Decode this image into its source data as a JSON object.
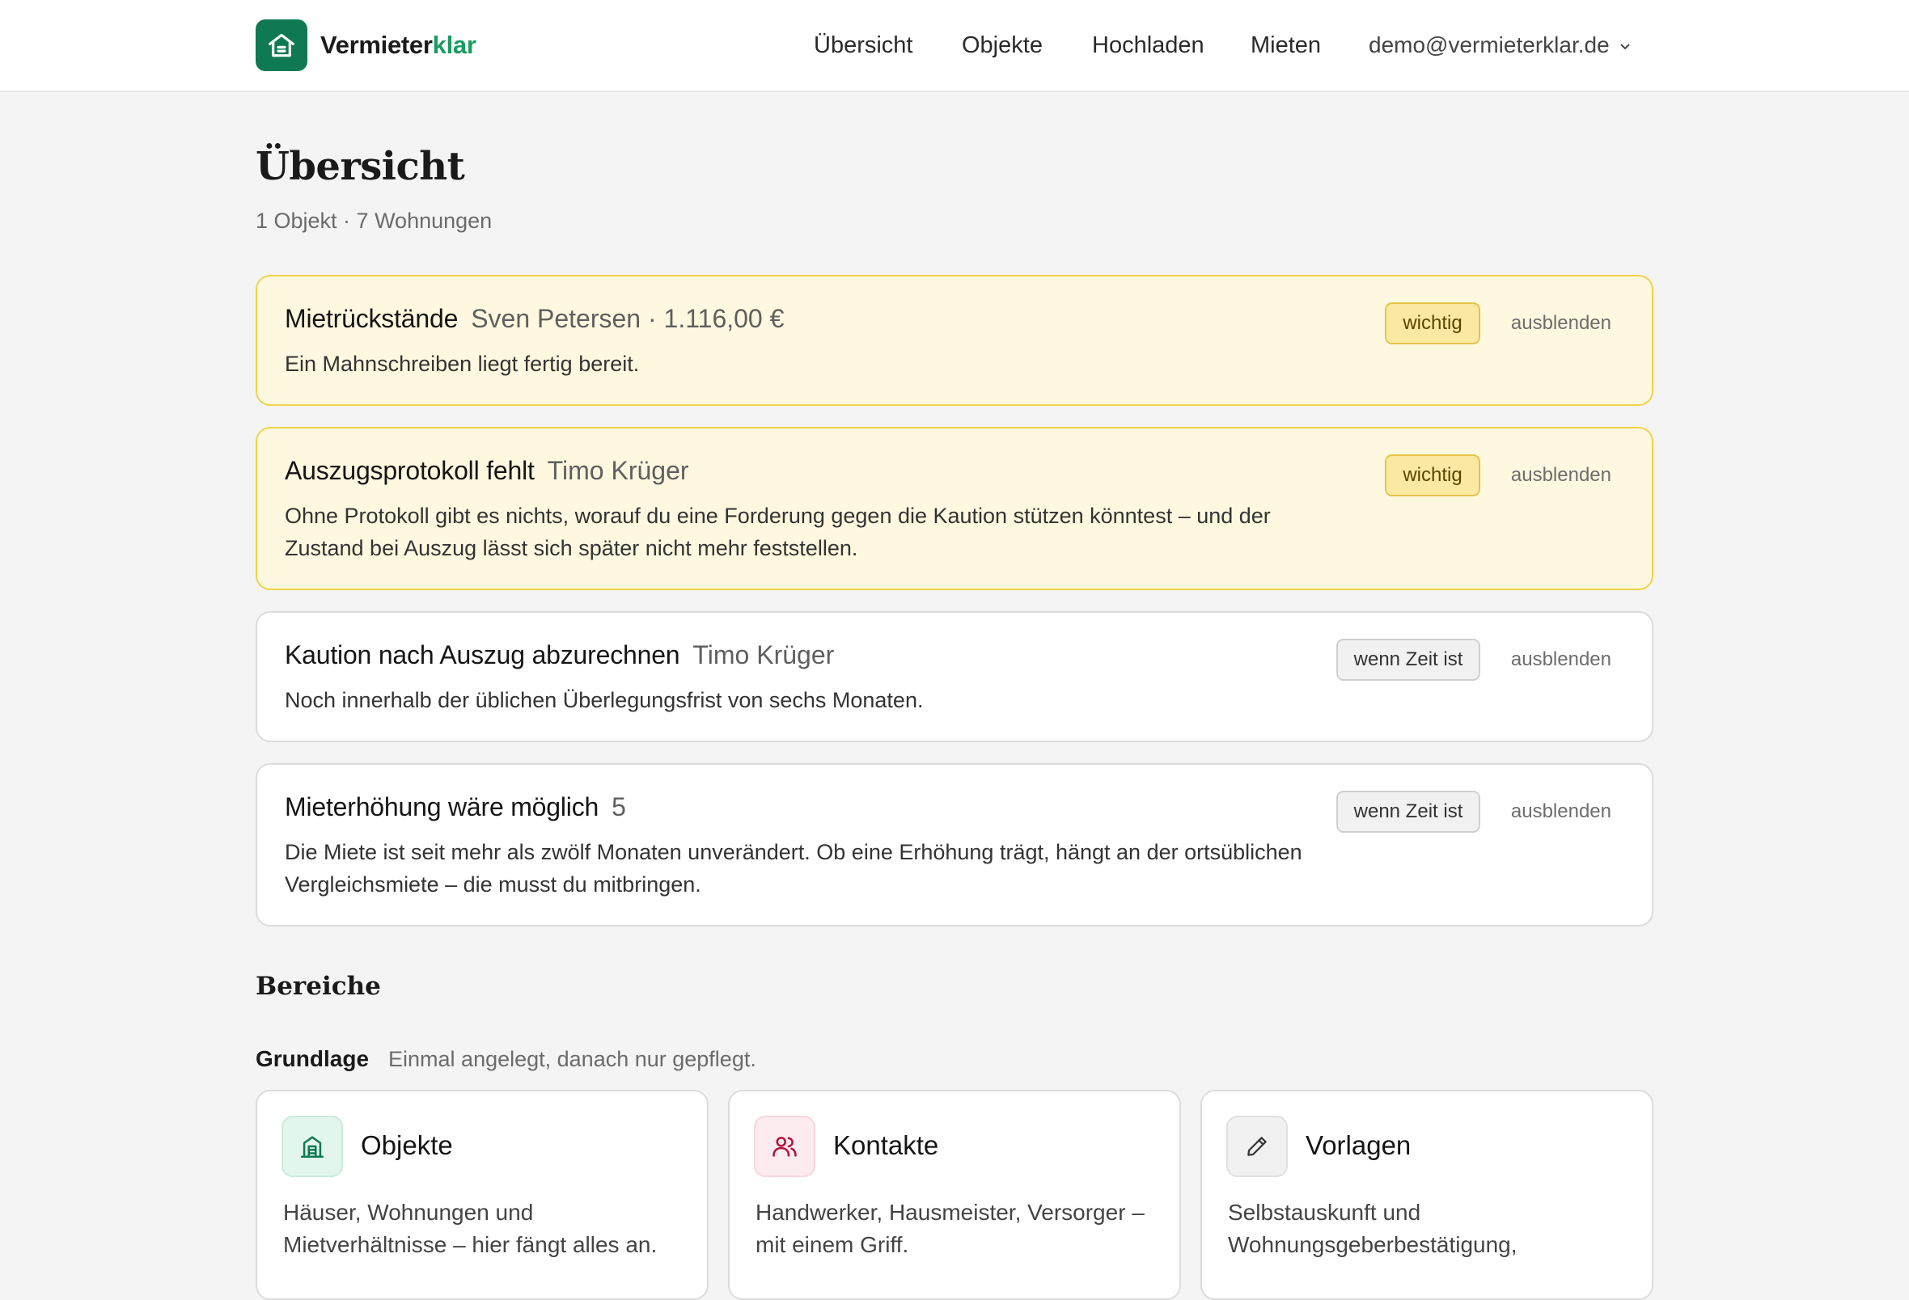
{
  "header": {
    "brand_part1": "Vermieter",
    "brand_part2": "klar",
    "nav": [
      "Übersicht",
      "Objekte",
      "Hochladen",
      "Mieten"
    ],
    "user_email": "demo@vermieterklar.de"
  },
  "page": {
    "title": "Übersicht",
    "subtitle": "1 Objekt · 7 Wohnungen"
  },
  "tasks": [
    {
      "title": "Mietrückstände",
      "sub": "Sven Petersen · 1.116,00 €",
      "body": "Ein Mahnschreiben liegt fertig bereit.",
      "badge": "wichtig",
      "hide": "ausblenden"
    },
    {
      "title": "Auszugsprotokoll fehlt",
      "sub": "Timo Krüger",
      "body": "Ohne Protokoll gibt es nichts, worauf du eine Forderung gegen die Kaution stützen könntest – und der Zustand bei Auszug lässt sich später nicht mehr feststellen.",
      "badge": "wichtig",
      "hide": "ausblenden"
    },
    {
      "title": "Kaution nach Auszug abzurechnen",
      "sub": "Timo Krüger",
      "body": "Noch innerhalb der üblichen Überlegungsfrist von sechs Monaten.",
      "badge": "wenn Zeit ist",
      "hide": "ausblenden"
    },
    {
      "title": "Mieterhöhung wäre möglich",
      "sub": "5",
      "body": "Die Miete ist seit mehr als zwölf Monaten unverändert. Ob eine Erhöhung trägt, hängt an der ortsüblichen Vergleichsmiete – die musst du mitbringen.",
      "badge": "wenn Zeit ist",
      "hide": "ausblenden"
    }
  ],
  "sections": {
    "title": "Bereiche",
    "group_name": "Grundlage",
    "group_desc": "Einmal angelegt, danach nur gepflegt.",
    "tiles": [
      {
        "title": "Objekte",
        "desc": "Häuser, Wohnungen und Mietverhältnisse – hier fängt alles an.",
        "icon": "building-icon"
      },
      {
        "title": "Kontakte",
        "desc": "Handwerker, Hausmeister, Versorger – mit einem Griff.",
        "icon": "users-icon"
      },
      {
        "title": "Vorlagen",
        "desc": "Selbstauskunft und Wohnungsgeberbestätigung,",
        "icon": "pencil-icon"
      }
    ]
  },
  "colors": {
    "brand": "#0f7a52",
    "warn_bg": "#fdf8df",
    "warn_border": "#f0d24a"
  }
}
